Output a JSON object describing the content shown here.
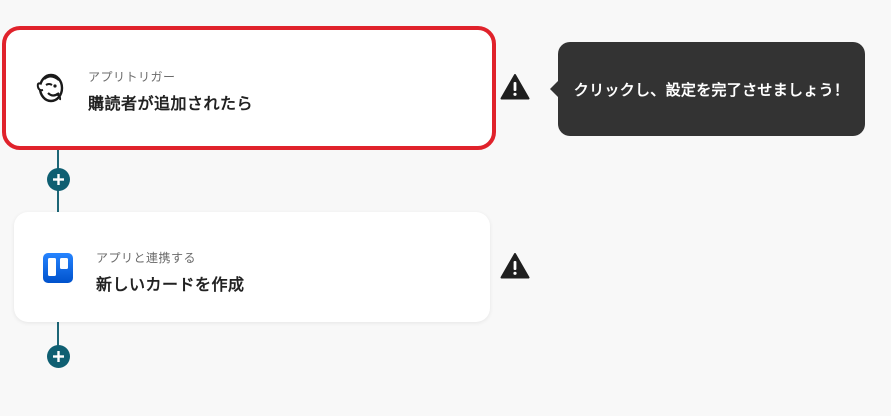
{
  "flow": {
    "steps": [
      {
        "subtitle": "アプリトリガー",
        "title": "購読者が追加されたら",
        "icon": "mailchimp-icon",
        "selected": true
      },
      {
        "subtitle": "アプリと連携する",
        "title": "新しいカードを作成",
        "icon": "trello-icon",
        "selected": false
      }
    ]
  },
  "tooltip": {
    "text": "クリックし、設定を完了させましょう！"
  },
  "icons": {
    "warning": "warning-icon",
    "add": "plus-icon"
  },
  "colors": {
    "selection_border": "#e0222b",
    "connector": "#1d6677",
    "add_button": "#0f5f72",
    "tooltip_bg": "#333333",
    "trello_blue": "#0c66e4"
  }
}
